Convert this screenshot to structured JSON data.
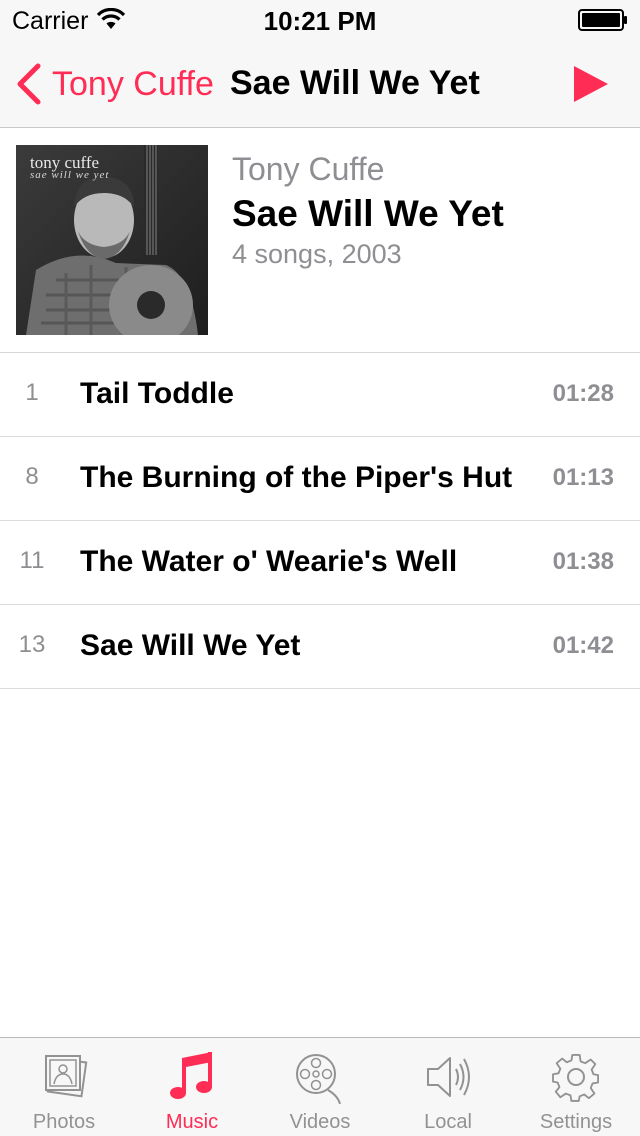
{
  "status_bar": {
    "carrier": "Carrier",
    "time": "10:21 PM"
  },
  "nav": {
    "back_label": "Tony Cuffe",
    "title": "Sae Will We Yet",
    "accent_color": "#ff2d55"
  },
  "album": {
    "artwork_artist": "tony cuffe",
    "artwork_title": "sae will we yet",
    "artist": "Tony Cuffe",
    "title": "Sae Will We Yet",
    "meta": "4 songs, 2003"
  },
  "songs": [
    {
      "number": "1",
      "title": "Tail Toddle",
      "duration": "01:28"
    },
    {
      "number": "8",
      "title": "The Burning of the Piper's Hut",
      "duration": "01:13"
    },
    {
      "number": "11",
      "title": "The Water o' Wearie's Well",
      "duration": "01:38"
    },
    {
      "number": "13",
      "title": "Sae Will We Yet",
      "duration": "01:42"
    }
  ],
  "tabs": [
    {
      "label": "Photos",
      "icon": "photos-icon",
      "active": false
    },
    {
      "label": "Music",
      "icon": "music-note-icon",
      "active": true
    },
    {
      "label": "Videos",
      "icon": "film-reel-icon",
      "active": false
    },
    {
      "label": "Local",
      "icon": "speaker-icon",
      "active": false
    },
    {
      "label": "Settings",
      "icon": "gear-icon",
      "active": false
    }
  ]
}
